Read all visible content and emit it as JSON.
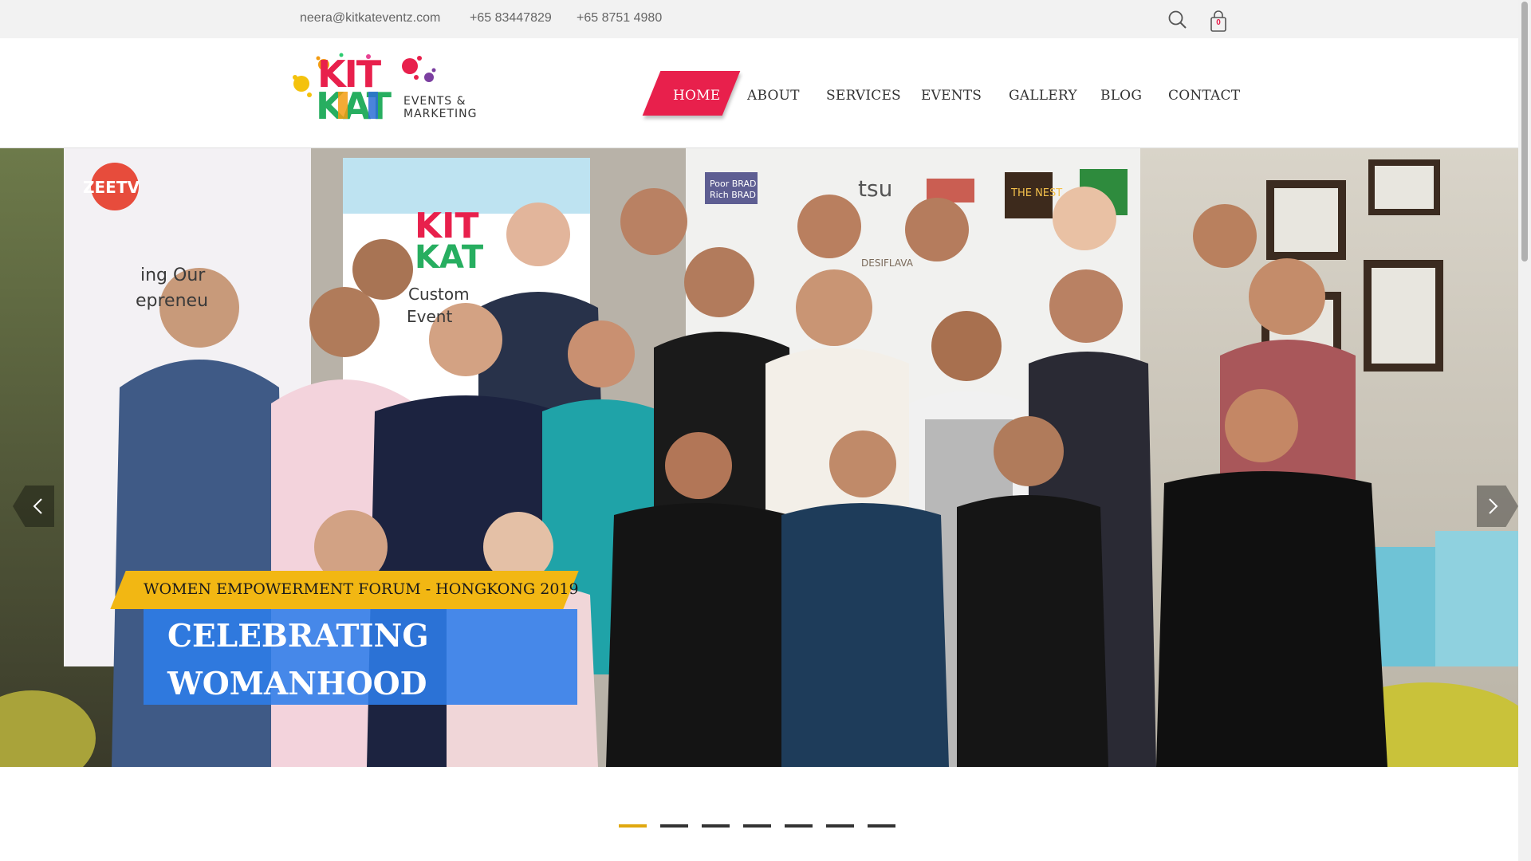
{
  "topbar": {
    "email": "neera@kitkateventz.com",
    "phone_1": "+65 83447829",
    "phone_2": "+65 8751 4980",
    "cart_count": "0"
  },
  "logo": {
    "line1": "KIT",
    "line2": "KAT",
    "tag1": "EVENTS &",
    "tag2": "MARKETING"
  },
  "nav": {
    "items": [
      {
        "label": "HOME",
        "active": true
      },
      {
        "label": "ABOUT"
      },
      {
        "label": "SERVICES"
      },
      {
        "label": "EVENTS"
      },
      {
        "label": "GALLERY"
      },
      {
        "label": "BLOG"
      },
      {
        "label": "CONTACT"
      }
    ]
  },
  "hero": {
    "tag": "WOMEN EMPOWERMENT FORUM - HONGKONG 2019",
    "title": "CELEBRATING WOMANHOOD",
    "backdrop_text": {
      "zee": "ZEETV",
      "wall_1": "ing Our",
      "wall_2": "epreneu",
      "banner_1": "Custom",
      "banner_2": "Event",
      "brand_1": "Poor BRAD",
      "brand_2": "Rich BRAD",
      "brand_3": "tsu",
      "brand_4": "THE NEST",
      "brand_5": "DESIFLAVA"
    }
  },
  "carousel": {
    "slide_count": 7,
    "active_index": 0
  },
  "colors": {
    "accent_red": "#e8204c",
    "accent_yellow": "#f2b713",
    "caption_blue": "#2d7deb"
  }
}
